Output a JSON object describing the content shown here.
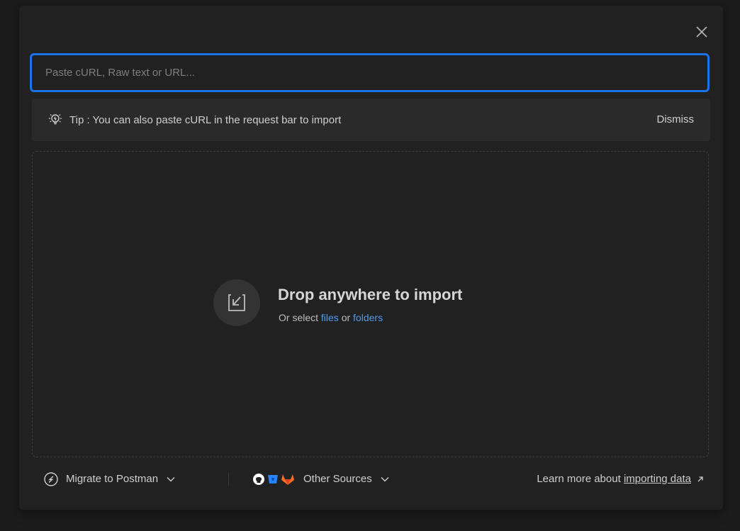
{
  "dialog": {
    "close_icon": "close-icon"
  },
  "import_input": {
    "placeholder": "Paste cURL, Raw text or URL...",
    "value": ""
  },
  "tip": {
    "icon": "lightbulb-icon",
    "text": "Tip : You can also paste cURL in the request bar to import",
    "dismiss_label": "Dismiss"
  },
  "drop_zone": {
    "icon": "import-tray-icon",
    "title": "Drop anywhere to import",
    "subtitle_prefix": "Or select",
    "files_link": "files",
    "or_text": "or",
    "folders_link": "folders"
  },
  "footer": {
    "migrate_label": "Migrate to Postman",
    "other_sources_label": "Other Sources",
    "source_icons": [
      "github-icon",
      "bitbucket-icon",
      "gitlab-icon"
    ],
    "learn_more_prefix": "Learn more about",
    "learn_more_link": "importing data"
  },
  "colors": {
    "accent": "#1a73e8",
    "link": "#4f9cf0",
    "background": "#212121"
  }
}
